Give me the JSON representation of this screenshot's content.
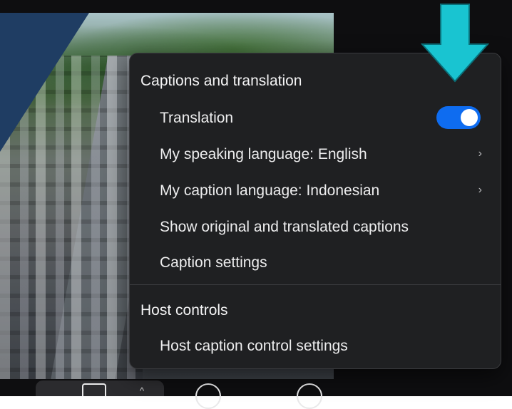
{
  "menu": {
    "captions_section_title": "Captions and translation",
    "items": [
      {
        "label": "Translation",
        "type": "toggle",
        "toggle_on": true
      },
      {
        "label": "My speaking language: English",
        "type": "submenu"
      },
      {
        "label": "My caption language: Indonesian",
        "type": "submenu"
      },
      {
        "label": "Show original and translated captions",
        "type": "action"
      },
      {
        "label": "Caption settings",
        "type": "action"
      }
    ],
    "host_section_title": "Host controls",
    "host_items": [
      {
        "label": "Host caption control settings",
        "type": "action"
      }
    ]
  },
  "toolbar": {
    "icons": [
      "cc-icon",
      "chevron-up-icon",
      "circle-icon",
      "circle-icon"
    ]
  },
  "colors": {
    "menu_background": "#1f2022",
    "toggle_on": "#0e6cf0",
    "arrow": "#19c4d1"
  }
}
